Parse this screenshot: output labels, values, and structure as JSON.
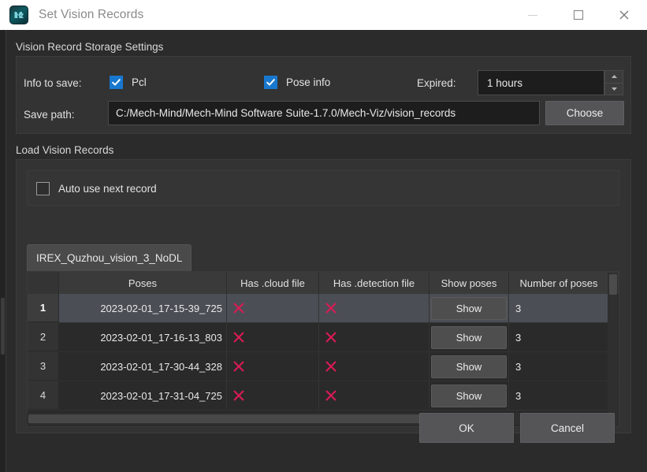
{
  "window": {
    "title": "Set Vision Records",
    "icon": "mech-viz-app-icon",
    "controls": {
      "minimize": "minimize-icon",
      "maximize": "maximize-icon",
      "close": "close-icon"
    }
  },
  "storage_section": {
    "title": "Vision Record Storage Settings",
    "info_to_save_label": "Info to save:",
    "checkboxes": [
      {
        "label": "Pcl",
        "checked": true
      },
      {
        "label": "Pose info",
        "checked": true
      }
    ],
    "expired_label": "Expired:",
    "expired_value": "1 hours",
    "save_path_label": "Save path:",
    "save_path_value": "C:/Mech-Mind/Mech-Mind Software Suite-1.7.0/Mech-Viz/vision_records",
    "choose_label": "Choose"
  },
  "load_section": {
    "title": "Load Vision Records",
    "auto_use_label": "Auto use next record",
    "auto_use_checked": false,
    "tab_label": "IREX_Quzhou_vision_3_NoDL",
    "table": {
      "headers": [
        "",
        "Poses",
        "Has .cloud file",
        "Has .detection file",
        "Show poses",
        "Number of poses"
      ],
      "rows": [
        {
          "index": "1",
          "poses": "2023-02-01_17-15-39_725",
          "has_cloud_file": "x-mark",
          "has_detection_file": "x-mark",
          "show_label": "Show",
          "number_of_poses": "3",
          "selected": true
        },
        {
          "index": "2",
          "poses": "2023-02-01_17-16-13_803",
          "has_cloud_file": "x-mark",
          "has_detection_file": "x-mark",
          "show_label": "Show",
          "number_of_poses": "3",
          "selected": false
        },
        {
          "index": "3",
          "poses": "2023-02-01_17-30-44_328",
          "has_cloud_file": "x-mark",
          "has_detection_file": "x-mark",
          "show_label": "Show",
          "number_of_poses": "3",
          "selected": false
        },
        {
          "index": "4",
          "poses": "2023-02-01_17-31-04_725",
          "has_cloud_file": "x-mark",
          "has_detection_file": "x-mark",
          "show_label": "Show",
          "number_of_poses": "3",
          "selected": false
        }
      ]
    }
  },
  "footer": {
    "ok_label": "OK",
    "cancel_label": "Cancel"
  },
  "colors": {
    "titlebar_bg": "#ffffff",
    "dialog_bg": "#2b2b2b",
    "panel_bg": "#333333",
    "accent_checkbox": "#1878cf",
    "x_mark": "#d81b55",
    "selected_row": "#4b4e55",
    "button_bg": "#555558",
    "text": "#e3e3e3"
  }
}
